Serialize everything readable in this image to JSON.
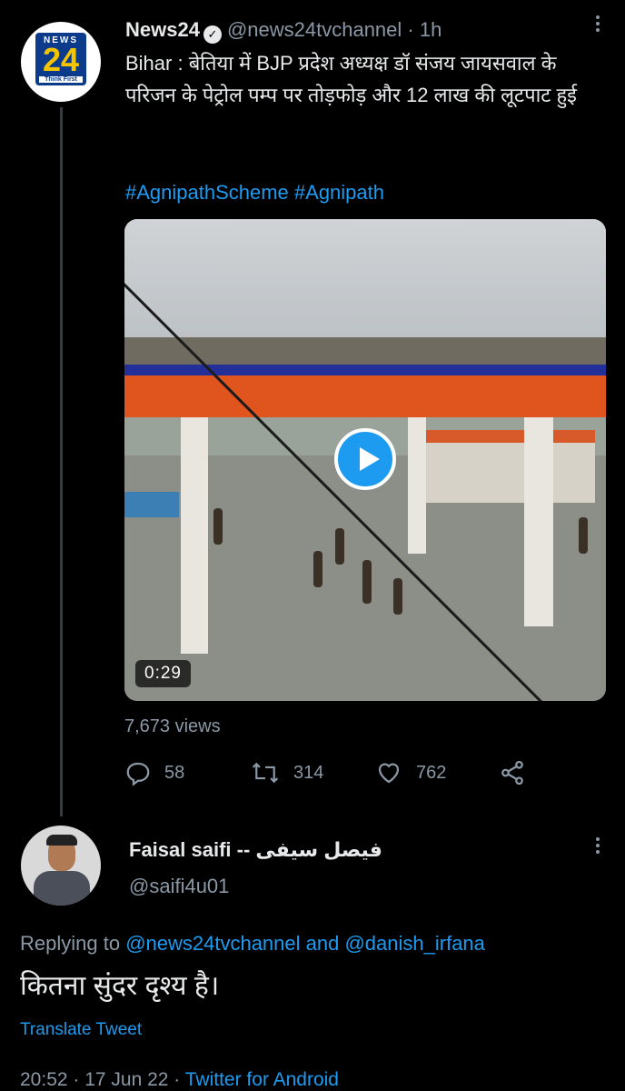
{
  "tweet": {
    "display_name": "News24",
    "handle": "@news24tvchannel",
    "separator": "·",
    "time": "1h",
    "text": "Bihar : बेतिया में BJP प्रदेश अध्यक्ष डॉ संजय जायसवाल के परिजन के पेट्रोल पम्प पर तोड़फोड़ और 12 लाख की लूटपाट हुई",
    "hashtags": "#AgnipathScheme #Agnipath",
    "avatar": {
      "top": "NEWS",
      "big": "24",
      "sub": "Think First"
    },
    "video": {
      "duration": "0:29"
    },
    "views": "7,673 views",
    "actions": {
      "replies": "58",
      "retweets": "314",
      "likes": "762"
    }
  },
  "reply": {
    "display_name": "Faisal saifi -- فيصل سيفى",
    "handle": "@saifi4u01",
    "replying_prefix": "Replying to ",
    "replying_user1": "@news24tvchannel",
    "replying_and": " and ",
    "replying_user2": "@danish_irfana",
    "text": "कितना सुंदर दृश्य है।",
    "translate": "Translate Tweet",
    "timestamp": "20:52 · 17 Jun 22 · ",
    "source": "Twitter for Android"
  },
  "colors": {
    "accent": "#1d9bf0",
    "muted": "#8b98a5",
    "background": "#000000"
  }
}
